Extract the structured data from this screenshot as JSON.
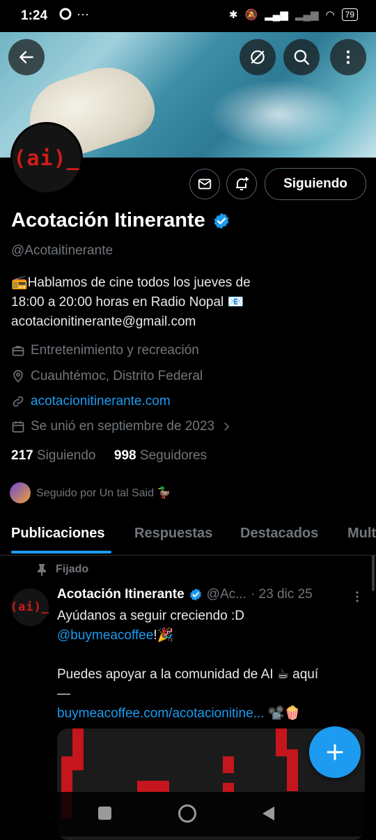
{
  "status_bar": {
    "time": "1:24",
    "dots": "···",
    "battery": "79"
  },
  "profile": {
    "name": "Acotación Itinerante",
    "handle": "@Acotaitinerante",
    "avatar_text": "(ai)_",
    "follow_label": "Siguiendo",
    "bio_line1": "📻Hablamos de cine todos los jueves de",
    "bio_line2": "18:00 a 20:00 horas en Radio Nopal 📧",
    "bio_line3": "acotacionitinerante@gmail.com",
    "category": "Entretenimiento y recreación",
    "location": "Cuauhtémoc, Distrito Federal",
    "website": "acotacionitinerante.com",
    "joined": "Se unió en septiembre de 2023",
    "following_count": "217",
    "following_label": "Siguiendo",
    "followers_count": "998",
    "followers_label": "Seguidores",
    "followed_by": "Seguido por Un tal Said 🦆"
  },
  "tabs": [
    "Publicaciones",
    "Respuestas",
    "Destacados",
    "Mult"
  ],
  "post": {
    "pinned_label": "Fijado",
    "author": "Acotación Itinerante",
    "handle": "@Ac...",
    "date": "· 23 dic 25",
    "line1": "Ayúdanos a seguir creciendo :D",
    "mention": "@buymeacoffee",
    "mention_suffix": "!🎉",
    "line3": "Puedes apoyar a la comunidad de AI ☕ aquí",
    "line4": "—",
    "link": "buymeacoffee.com/acotacionitine...",
    "link_suffix": " 📽️🍿"
  },
  "colors": {
    "accent": "#1d9bf0",
    "logo_red": "#d21b1b",
    "muted": "#71767b"
  }
}
